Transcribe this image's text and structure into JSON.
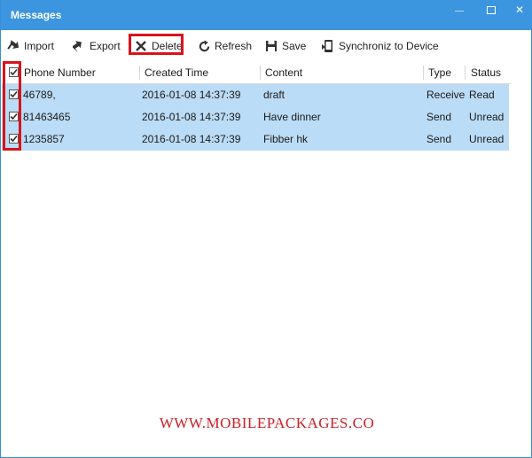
{
  "window": {
    "title": "Messages",
    "controls": {
      "minimize": "minimize-icon",
      "maximize": "maximize-icon",
      "close": "✕"
    }
  },
  "toolbar": {
    "import_label": "Import",
    "export_label": "Export",
    "delete_label": "Delete",
    "refresh_label": "Refresh",
    "save_label": "Save",
    "sync_label": "Synchroniz to Device"
  },
  "table": {
    "columns": [
      "Phone Number",
      "Created Time",
      "Content",
      "Type",
      "Status"
    ],
    "select_all_checked": true,
    "rows": [
      {
        "checked": true,
        "phone": "46789,",
        "created": "2016-01-08 14:37:39",
        "content": "draft",
        "type": "Receive",
        "status": "Read"
      },
      {
        "checked": true,
        "phone": "81463465",
        "created": "2016-01-08 14:37:39",
        "content": "Have dinner",
        "type": "Send",
        "status": "Unread"
      },
      {
        "checked": true,
        "phone": "1235857",
        "created": "2016-01-08 14:37:39",
        "content": "Fibber hk",
        "type": "Send",
        "status": "Unread"
      }
    ]
  },
  "watermark": "WWW.MOBILEPACKAGES.CO",
  "colors": {
    "titlebar": "#3c96df",
    "row_selected": "#bbdcf6",
    "highlight": "#d9131b",
    "watermark": "#cc1f27"
  }
}
